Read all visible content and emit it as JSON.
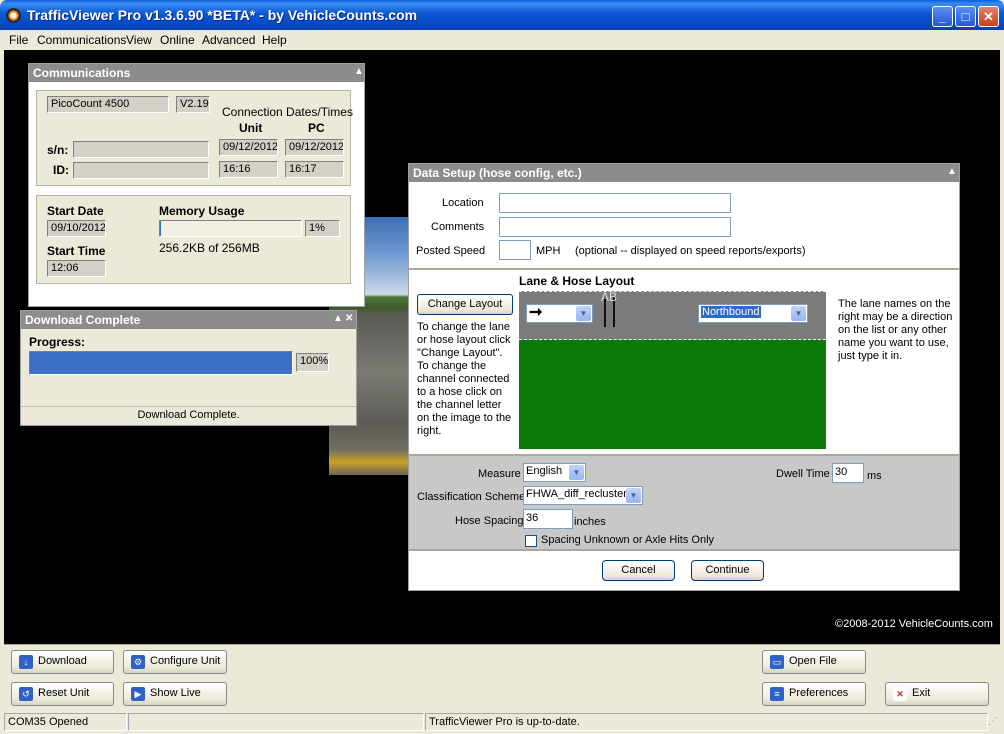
{
  "window": {
    "title": "TrafficViewer Pro  v1.3.6.90 *BETA* - by VehicleCounts.com"
  },
  "menu": [
    "File",
    "Communications",
    "View",
    "Online",
    "Advanced",
    "Help"
  ],
  "communications": {
    "title": "Communications",
    "device": "PicoCount 4500",
    "version": "V2.19",
    "conn_header": "Connection Dates/Times",
    "unit_label": "Unit",
    "pc_label": "PC",
    "sn_label": "s/n:",
    "id_label": "ID:",
    "sn_value": "",
    "id_value": "",
    "unit_date": "09/12/2012",
    "pc_date": "09/12/2012",
    "unit_time": "16:16",
    "pc_time": "16:17",
    "start_date_label": "Start Date",
    "start_date": "09/10/2012",
    "start_time_label": "Start Time",
    "start_time": "12:06",
    "memory_label": "Memory Usage",
    "memory_percent": "1%",
    "memory_fraction": 0.01,
    "memory_detail": "256.2KB of 256MB"
  },
  "download": {
    "title": "Download Complete",
    "progress_label": "Progress:",
    "percent": "100%",
    "fraction": 1.0,
    "status": "Download Complete."
  },
  "setup": {
    "title": "Data Setup (hose config, etc.)",
    "location_label": "Location",
    "location_value": "",
    "comments_label": "Comments",
    "comments_value": "",
    "speed_label": "Posted Speed",
    "speed_value": "",
    "speed_unit": "MPH",
    "speed_note": "(optional -- displayed on speed reports/exports)",
    "layout_title": "Lane & Hose Layout",
    "change_layout": "Change Layout",
    "help_left": "To change the lane or hose layout click \"Change Layout\". To change the channel connected to a hose click on the channel letter on the image to the right.",
    "hose_label": "AB",
    "lane_name": "Northbound",
    "help_right": "The lane names on the right may be a direction on the list or any other name you want to use, just type it in.",
    "measure_label": "Measure",
    "measure_value": "English",
    "dwell_label": "Dwell Time",
    "dwell_value": "30",
    "dwell_unit": "ms",
    "class_label": "Classification Scheme",
    "class_value": "FHWA_diff_recluster",
    "spacing_label": "Hose Spacing",
    "spacing_value": "36",
    "spacing_unit": "inches",
    "checkbox_label": "Spacing Unknown or Axle Hits Only",
    "checkbox_checked": false,
    "cancel": "Cancel",
    "continue": "Continue"
  },
  "copyright": "©2008-2012 VehicleCounts.com",
  "buttons": {
    "download": "Download",
    "configure": "Configure Unit",
    "open_file": "Open File",
    "reset": "Reset Unit",
    "show_live": "Show Live",
    "preferences": "Preferences",
    "exit": "Exit"
  },
  "status": {
    "port": "COM35 Opened",
    "middle": "",
    "message": "TrafficViewer Pro is up-to-date."
  }
}
